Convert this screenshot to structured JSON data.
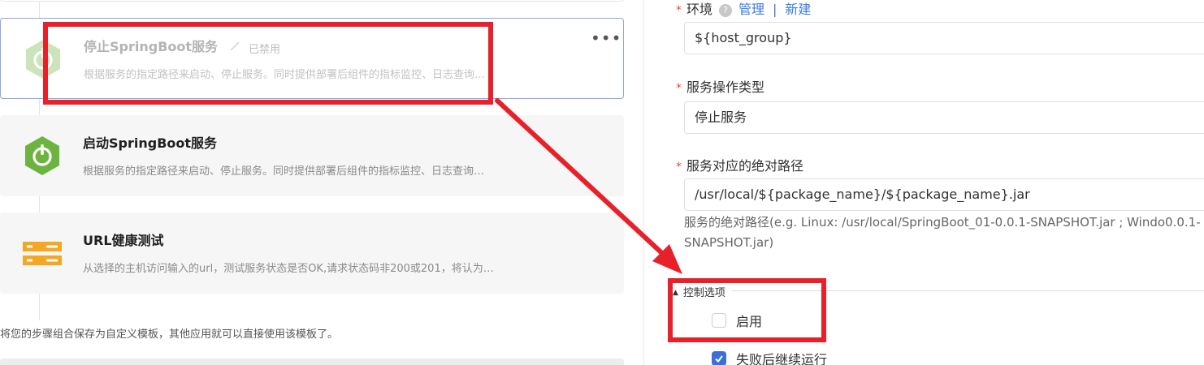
{
  "steps": [
    {
      "title": "停止SpringBoot服务",
      "status": "已禁用",
      "description": "根据服务的指定路径来启动、停止服务。同时提供部署后组件的指标监控、日志查询…",
      "icon": "springboot-power-icon",
      "disabled": true
    },
    {
      "title": "启动SpringBoot服务",
      "description": "根据服务的指定路径来启动、停止服务。同时提供部署后组件的指标监控、日志查询…",
      "icon": "springboot-power-icon"
    },
    {
      "title": "URL健康测试",
      "description": "从选择的主机访问输入的url，测试服务状态是否OK,请求状态码非200或201，将认为…",
      "icon": "server-list-icon"
    }
  ],
  "template_tip": "将您的步骤组合保存为自定义模板，其他应用就可以直接使用该模板了。",
  "form": {
    "environment": {
      "label": "环境",
      "manage_link": "管理",
      "separator": "|",
      "new_link": "新建",
      "value": "${host_group}"
    },
    "operation_type": {
      "label": "服务操作类型",
      "value": "停止服务"
    },
    "absolute_path": {
      "label": "服务对应的绝对路径",
      "value": "/usr/local/${package_name}/${package_name}.jar",
      "hint": "服务的绝对路径(e.g. Linux: /usr/local/SpringBoot_01-0.0.1-SNAPSHOT.jar ; Windo​0.0.1-SNAPSHOT.jar)"
    },
    "control_options": {
      "legend": "控制选项",
      "enable_label": "启用",
      "enable_checked": false,
      "continue_on_fail_label": "失败后继续运行",
      "continue_on_fail_checked": true
    }
  },
  "colors": {
    "accent_blue": "#3b7ddd",
    "springboot_green": "#6db33f",
    "url_orange": "#f5a623",
    "annotation_red": "#e8202a",
    "required_red": "#e84a3c"
  }
}
